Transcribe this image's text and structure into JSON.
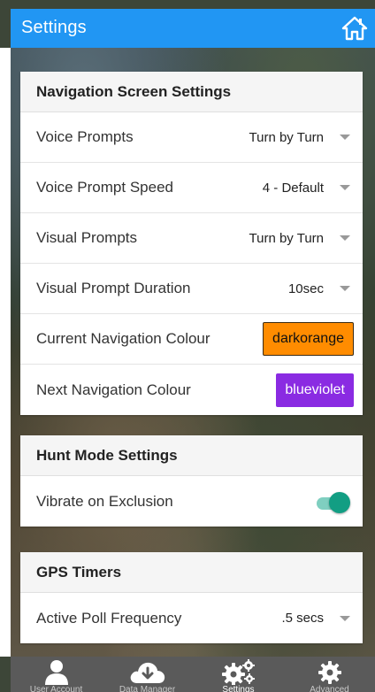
{
  "header": {
    "title": "Settings",
    "home_icon": "home-icon"
  },
  "navigation_card": {
    "title": "Navigation Screen Settings",
    "rows": [
      {
        "label": "Voice Prompts",
        "value": "Turn by Turn"
      },
      {
        "label": "Voice Prompt Speed",
        "value": "4 - Default"
      },
      {
        "label": "Visual Prompts",
        "value": "Turn by Turn"
      },
      {
        "label": "Visual Prompt Duration",
        "value": "10sec"
      }
    ],
    "current_colour": {
      "label": "Current Navigation Colour",
      "value": "darkorange",
      "color": "#ff8c00"
    },
    "next_colour": {
      "label": "Next Navigation Colour",
      "value": "blueviolet",
      "color": "#8a2be2"
    }
  },
  "hunt_card": {
    "title": "Hunt Mode Settings",
    "vibrate": {
      "label": "Vibrate on Exclusion",
      "on": true
    }
  },
  "gps_card": {
    "title": "GPS Timers",
    "poll": {
      "label": "Active Poll Frequency",
      "value": ".5 secs"
    }
  },
  "tabbar": {
    "tabs": [
      {
        "label": "User Account",
        "icon": "user-icon"
      },
      {
        "label": "Data Manager",
        "icon": "cloud-download-icon"
      },
      {
        "label": "Settings",
        "icon": "gears-icon",
        "active": true
      },
      {
        "label": "Advanced",
        "icon": "gear-icon"
      }
    ]
  },
  "colors": {
    "header": "#2196f3",
    "toggle_on": "#129e83",
    "tabbar": "#5a5a5a"
  }
}
